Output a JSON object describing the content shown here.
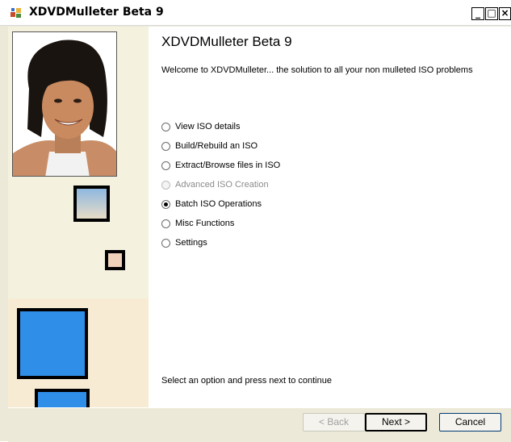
{
  "window": {
    "title": "XDVDMulleter Beta 9",
    "buttons": {
      "minimize": "_",
      "maximize": "□",
      "close": "×"
    }
  },
  "main": {
    "heading": "XDVDMulleter Beta 9",
    "welcome": "Welcome to XDVDMulleter... the solution to all your non mulleted ISO problems",
    "options": [
      {
        "label": "View ISO details",
        "checked": false,
        "enabled": true
      },
      {
        "label": "Build/Rebuild an ISO",
        "checked": false,
        "enabled": true
      },
      {
        "label": "Extract/Browse files in ISO",
        "checked": false,
        "enabled": true
      },
      {
        "label": "Advanced ISO Creation",
        "checked": false,
        "enabled": false
      },
      {
        "label": "Batch ISO Operations",
        "checked": true,
        "enabled": true
      },
      {
        "label": "Misc Functions",
        "checked": false,
        "enabled": true
      },
      {
        "label": "Settings",
        "checked": false,
        "enabled": true
      }
    ],
    "status": "Select an option and press next to continue"
  },
  "footer": {
    "back_label": "< Back",
    "next_label": "Next >",
    "cancel_label": "Cancel"
  },
  "colors": {
    "panel_square_blue": "#2f8fe8",
    "accent_border": "#003c74"
  }
}
